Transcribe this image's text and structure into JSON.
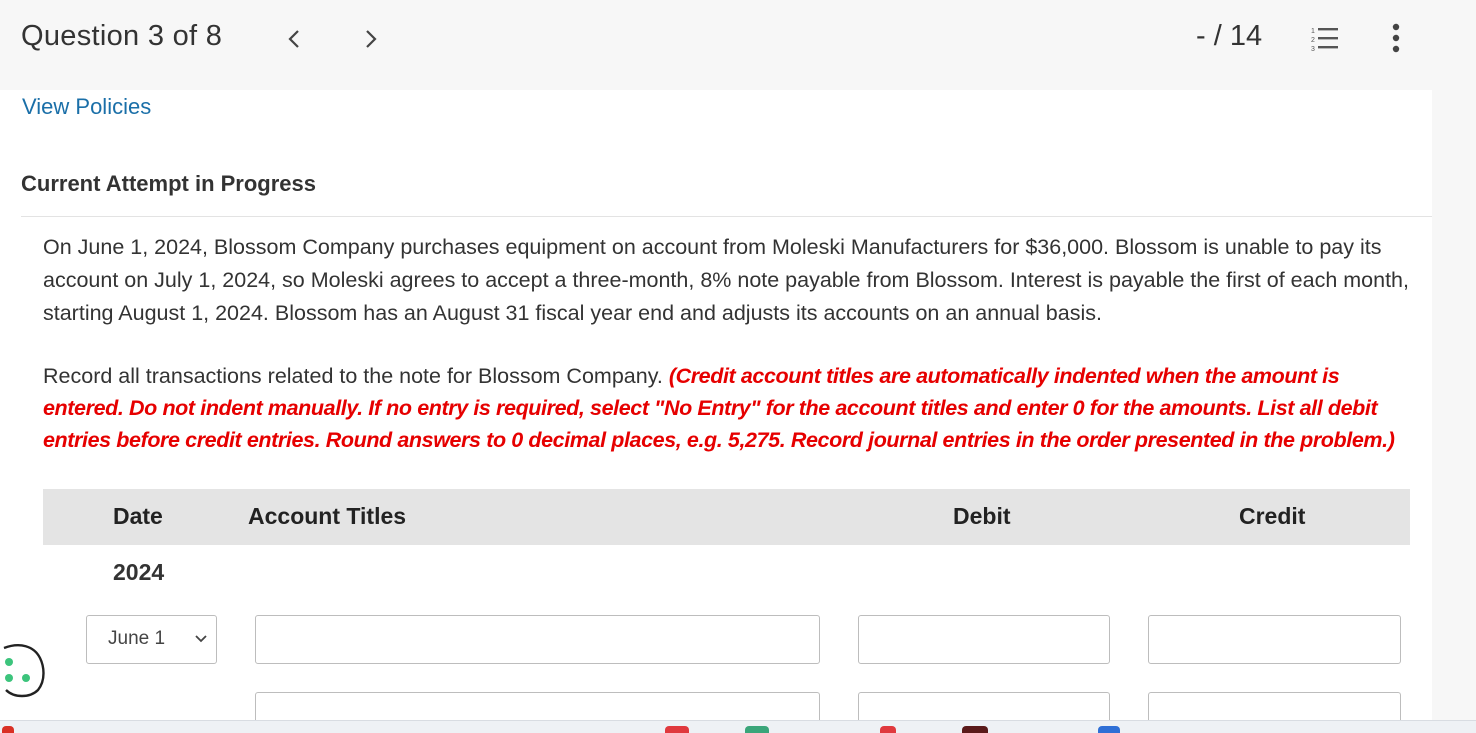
{
  "header": {
    "question_label": "Question 3 of 8",
    "score": "- / 14",
    "icons": [
      "chevron-left-icon",
      "chevron-right-icon",
      "numbered-list-icon",
      "more-vertical-icon"
    ]
  },
  "policies_link": "View Policies",
  "attempt_status": "Current Attempt in Progress",
  "problem_text": "On June 1, 2024, Blossom Company purchases equipment on account from Moleski Manufacturers for $36,000. Blossom is unable to pay its account on July 1, 2024, so Moleski agrees to accept a three-month, 8% note payable from Blossom. Interest is payable the first of each month, starting August 1, 2024. Blossom has an August 31 fiscal year end and adjusts its accounts on an annual basis.",
  "instructions": {
    "lead": "Record all transactions related to the note for Blossom Company. ",
    "note": "(Credit account titles are automatically indented when the amount is entered. Do not indent manually. If no entry is required, select \"No Entry\" for the account titles and enter 0 for the amounts. List all debit entries before credit entries. Round answers to 0 decimal places, e.g. 5,275. Record journal entries in the order presented in the problem.)"
  },
  "table": {
    "headers": {
      "date": "Date",
      "account_titles": "Account Titles",
      "debit": "Debit",
      "credit": "Credit"
    },
    "year": "2024",
    "rows": [
      {
        "date": "June 1",
        "account_title": "",
        "debit": "",
        "credit": ""
      },
      {
        "date": "",
        "account_title": "",
        "debit": "",
        "credit": ""
      }
    ]
  },
  "colors": {
    "link": "#1a6fa8",
    "instruction_red": "#e60000",
    "header_bg": "#f7f7f7",
    "table_header_bg": "#e4e4e4",
    "cookie_green": "#3cc47c"
  }
}
